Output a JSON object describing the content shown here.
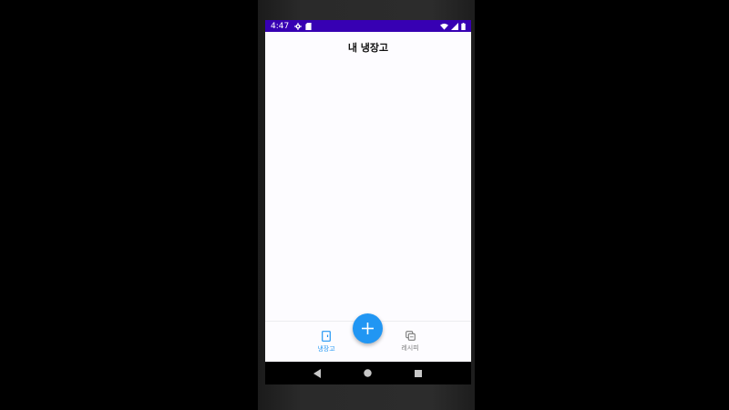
{
  "status_bar": {
    "time": "4:47",
    "left_icons": [
      "gear-icon",
      "sd-card-icon"
    ],
    "right_icons": [
      "wifi-icon",
      "signal-icon",
      "battery-icon"
    ],
    "color": "#3700b3"
  },
  "app": {
    "title": "내 냉장고"
  },
  "bottom_nav": {
    "items": [
      {
        "label": "냉장고",
        "icon": "fridge-icon",
        "active": true
      },
      {
        "label": "레시피",
        "icon": "recipe-icon",
        "active": false
      }
    ],
    "active_color": "#2196f3",
    "inactive_color": "#7a7a7a"
  },
  "fab": {
    "icon": "plus-icon",
    "color": "#2196f3"
  },
  "system_nav": {
    "buttons": [
      "back-icon",
      "home-icon",
      "recents-icon"
    ]
  }
}
